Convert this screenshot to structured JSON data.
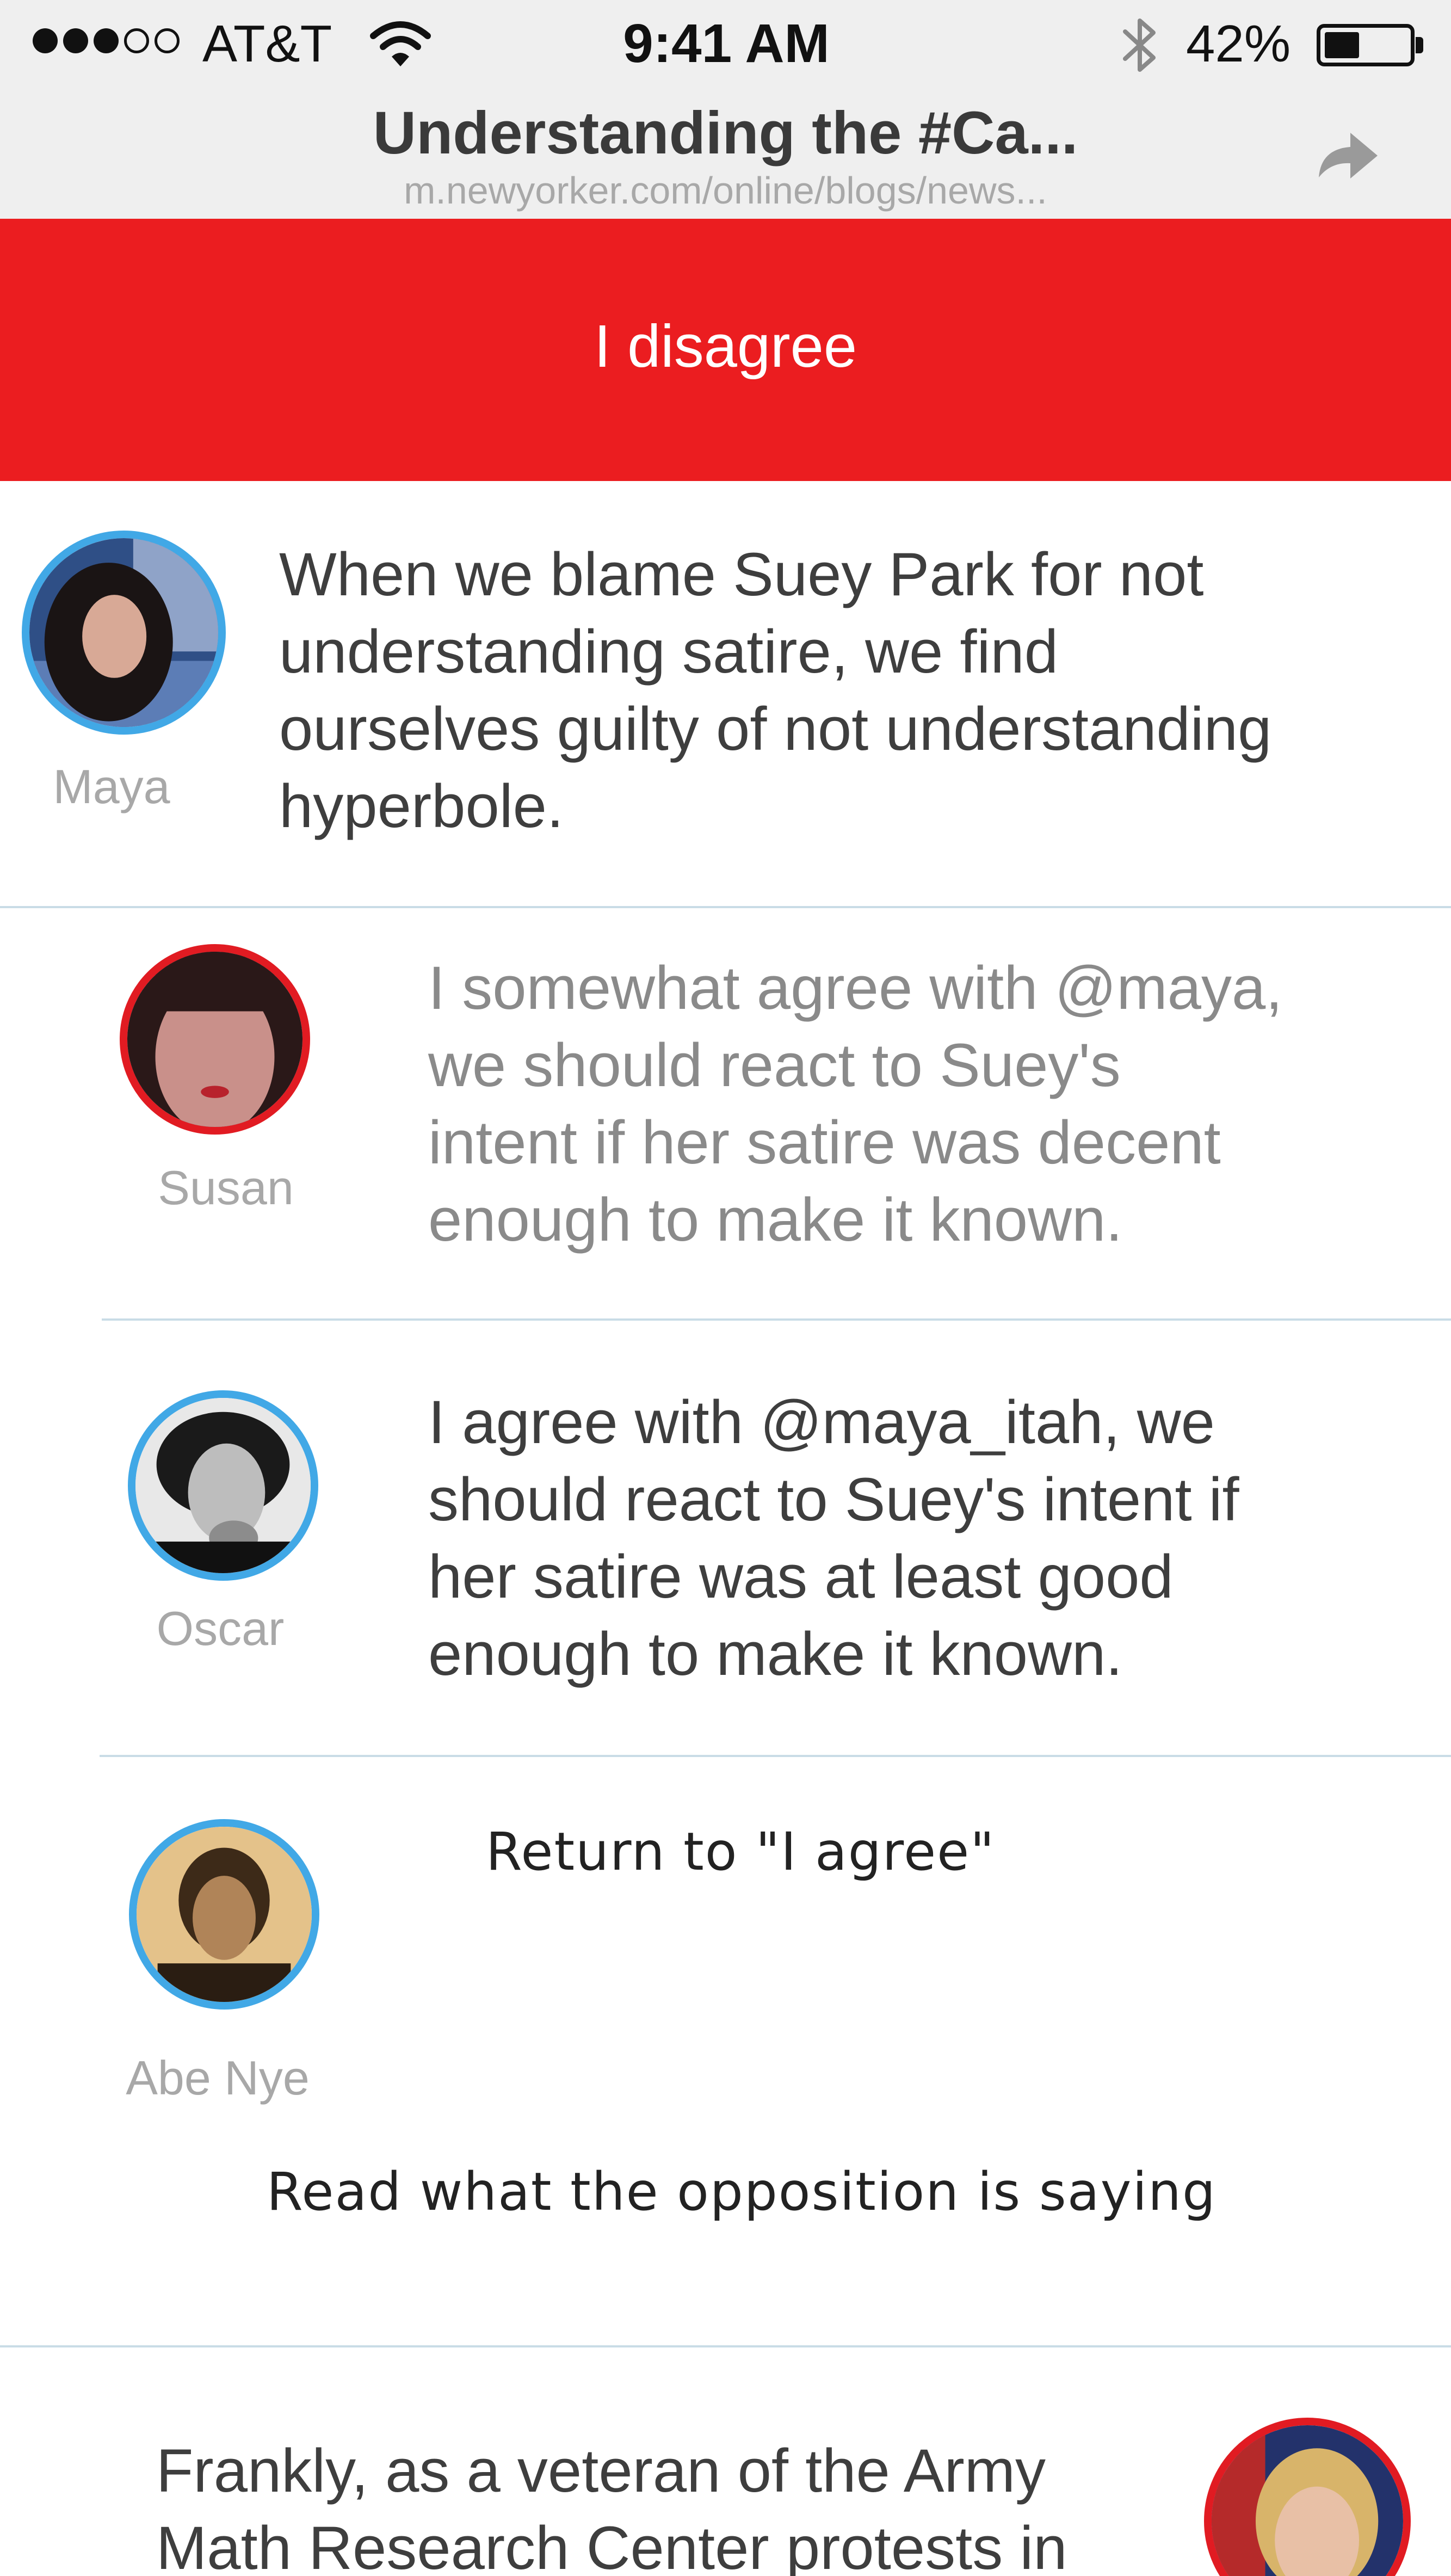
{
  "status_bar": {
    "carrier": "AT&T",
    "signal_bars_filled": 3,
    "signal_bars_total": 5,
    "time": "9:41 AM",
    "battery_percent": "42%",
    "battery_level": 0.42
  },
  "browser": {
    "title": "Understanding the #Ca...",
    "url": "m.newyorker.com/online/blogs/news..."
  },
  "banner": {
    "label": "I disagree",
    "color": "#eb1d20"
  },
  "comments": [
    {
      "author": "Maya",
      "text": [
        "When we blame Suey Park for not",
        "understanding satire, we find",
        "ourselves guilty of not understanding",
        "hyperbole."
      ]
    },
    {
      "author": "Susan",
      "text": [
        "I somewhat agree with @maya,",
        "we should react to Suey's",
        "intent if her satire was decent",
        "enough to make it known."
      ]
    },
    {
      "author": "Oscar",
      "text": [
        "I agree with @maya_itah, we",
        "should react to Suey's intent if",
        "her satire was at least good",
        "enough to make it known."
      ]
    },
    {
      "author": "Abe Nye"
    },
    {
      "text": [
        "Frankly, as a veteran of the Army",
        "Math Research Center protests in"
      ]
    }
  ],
  "links": {
    "return": "Return to \"I agree\"",
    "opposition": "Read what the opposition is saying"
  },
  "colors": {
    "agree_ring": "#41a8e6",
    "disagree_ring": "#e11b22",
    "divider": "#c9dce6"
  }
}
